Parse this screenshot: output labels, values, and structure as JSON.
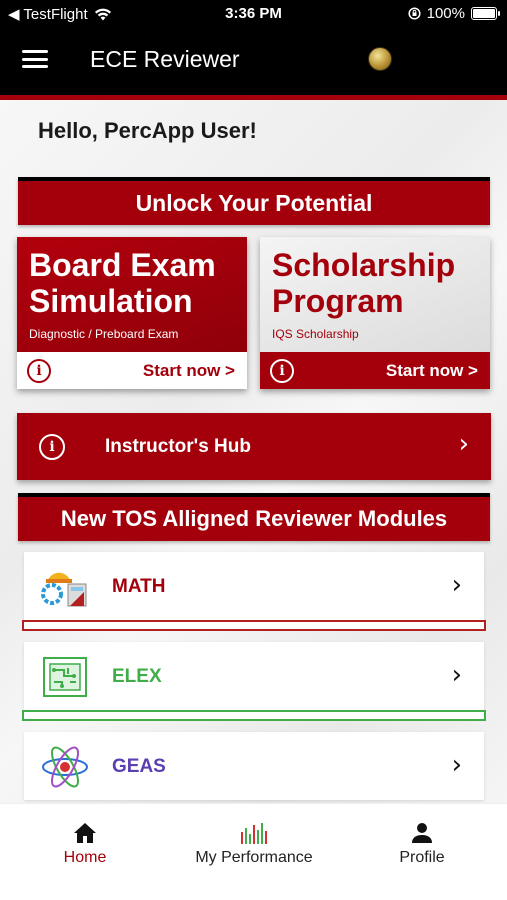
{
  "status_bar": {
    "carrier": "◀ TestFlight",
    "time": "3:36 PM",
    "battery": "100%"
  },
  "app_bar": {
    "title": "ECE Reviewer"
  },
  "greeting": "Hello, PercApp User!",
  "banner_unlock": "Unlock Your Potential",
  "cards": [
    {
      "title_line1": "Board Exam",
      "title_line2": "Simulation",
      "subtitle": "Diagnostic / Preboard Exam",
      "cta": "Start now >"
    },
    {
      "title_line1": "Scholarship",
      "title_line2": "Program",
      "subtitle": "IQS Scholarship",
      "cta": "Start now >"
    }
  ],
  "hub": {
    "label": "Instructor's Hub"
  },
  "banner_modules": "New TOS Alligned Reviewer Modules",
  "modules": [
    {
      "label": "MATH",
      "color": "#a3000b",
      "accent": "#b32020"
    },
    {
      "label": "ELEX",
      "color": "#3fae49",
      "accent": "#3fae49"
    },
    {
      "label": "GEAS",
      "color": "#5b3fb0",
      "accent": "#5b3fb0"
    }
  ],
  "bottom_nav": {
    "home": "Home",
    "performance": "My Performance",
    "profile": "Profile"
  },
  "colors": {
    "brand_red": "#a3000b",
    "topbar": "#000000"
  }
}
